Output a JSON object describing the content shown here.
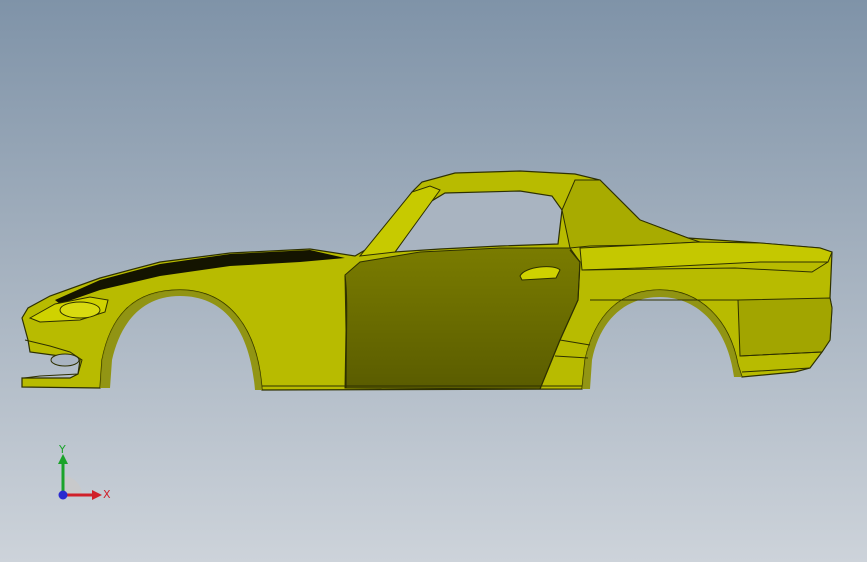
{
  "viewport": {
    "background_top": "#7f93a8",
    "background_bottom": "#cdd3da"
  },
  "model": {
    "body_color": "#b8bb00",
    "shade_color": "#5f6200",
    "edge_color": "#2e3000",
    "hood_stripe_color": "#141400"
  },
  "triad": {
    "y_label": "Y",
    "x_label": "X",
    "y_color": "#1aa32a",
    "x_color": "#d0202a",
    "z_color": "#2a2ad0"
  }
}
